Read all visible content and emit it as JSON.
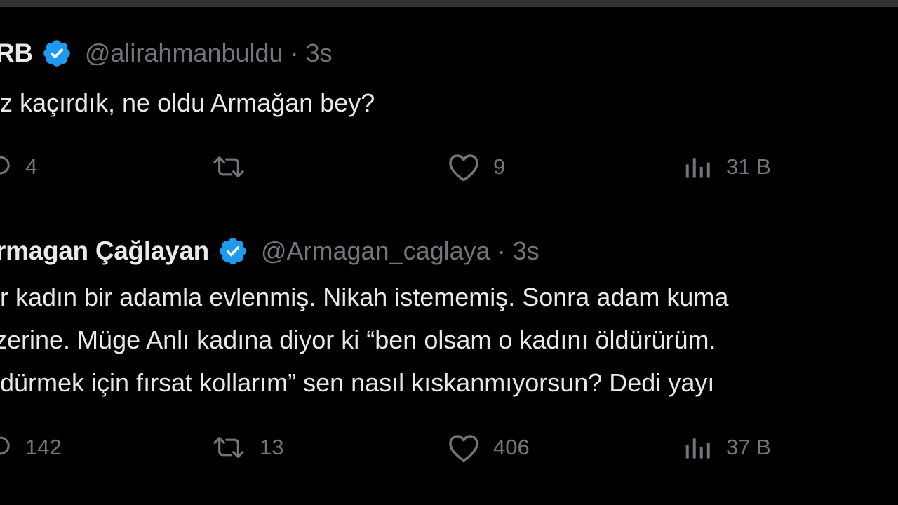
{
  "colors": {
    "background": "#000000",
    "text_primary": "#e7e9ea",
    "text_secondary": "#71767b",
    "verified_badge": "#1d9bf0"
  },
  "tweets": [
    {
      "author": "RB",
      "verified_icon": "verified-badge-icon",
      "handle": "@alirahmanbuldu",
      "separator": "·",
      "time": "3s",
      "body_lines": [
        "iz kaçırdık, ne oldu Armağan bey?"
      ],
      "actions": {
        "reply": {
          "icon": "reply-icon",
          "count": "4"
        },
        "retweet": {
          "icon": "retweet-icon",
          "count": ""
        },
        "like": {
          "icon": "heart-icon",
          "count": "9"
        },
        "views": {
          "icon": "views-icon",
          "count": "31 B"
        }
      }
    },
    {
      "author": "rmagan Çağlayan",
      "verified_icon": "verified-badge-icon",
      "handle": "@Armagan_caglaya",
      "separator": "·",
      "time": "3s",
      "body_lines": [
        "ir kadın bir adamla evlenmiş. Nikah istememiş. Sonra adam kuma",
        "zerine. Müge Anlı kadına diyor ki “ben olsam o kadını öldürürüm.",
        "ldürmek için  fırsat kollarım” sen nasıl kıskanmıyorsun? Dedi yayı"
      ],
      "actions": {
        "reply": {
          "icon": "reply-icon",
          "count": "142"
        },
        "retweet": {
          "icon": "retweet-icon",
          "count": "13"
        },
        "like": {
          "icon": "heart-icon",
          "count": "406"
        },
        "views": {
          "icon": "views-icon",
          "count": "37 B"
        }
      }
    }
  ]
}
